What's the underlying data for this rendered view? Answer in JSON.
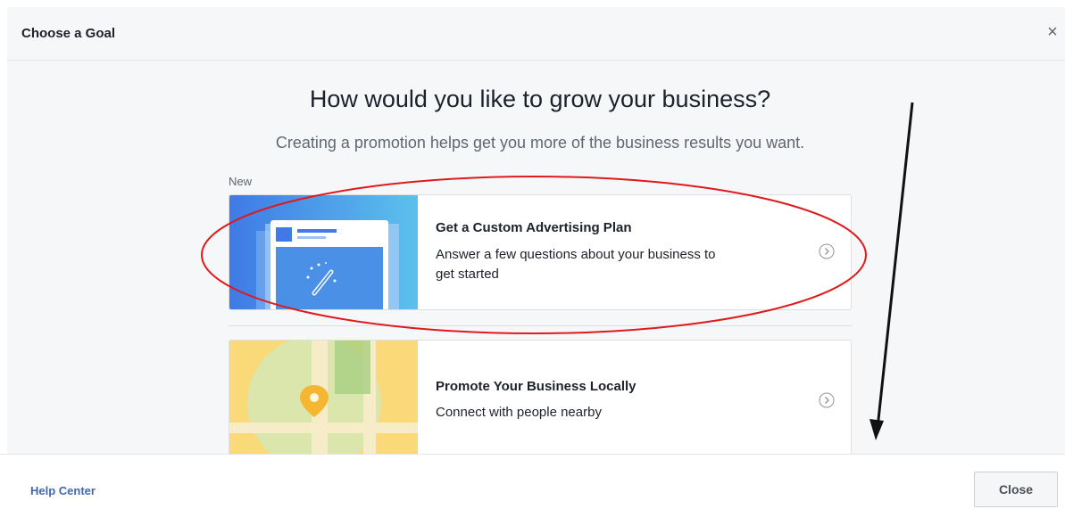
{
  "dialog": {
    "title": "Choose a Goal",
    "close_glyph": "×"
  },
  "main": {
    "headline": "How would you like to grow your business?",
    "subline": "Creating a promotion helps get you more of the business results you want.",
    "new_label": "New"
  },
  "cards": [
    {
      "title": "Get a Custom Advertising Plan",
      "desc": "Answer a few questions about your business to get started",
      "icon": "magic-wand-icon"
    },
    {
      "title": "Promote Your Business Locally",
      "desc": "Connect with people nearby",
      "icon": "map-pin-icon"
    }
  ],
  "footer": {
    "help_label": "Help Center",
    "close_label": "Close"
  },
  "colors": {
    "link": "#4267b2",
    "annotation_red": "#e0191d",
    "card1_gradient_start": "#3f7ae6",
    "card1_gradient_end": "#5cc1ec",
    "card2_background": "#f9d978",
    "pin": "#f5b731"
  }
}
